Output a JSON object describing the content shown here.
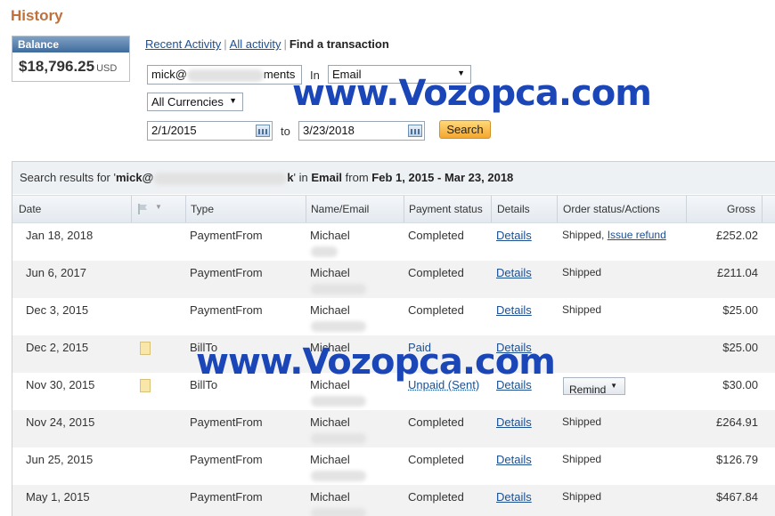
{
  "page": {
    "title": "History"
  },
  "balance": {
    "label": "Balance",
    "amount": "$18,796.25",
    "currency": "USD"
  },
  "tabs": {
    "recent": "Recent Activity",
    "all": "All activity",
    "find": "Find a transaction",
    "separator": "|"
  },
  "search": {
    "query_visible": "mick@",
    "query_suffix": "ments",
    "in_label": "In",
    "in_value": "Email",
    "currency_value": "All Currencies",
    "from_date": "2/1/2015",
    "to_label": "to",
    "to_date": "3/23/2018",
    "button": "Search"
  },
  "watermark": {
    "text": "www.Vozopca.com"
  },
  "results": {
    "prefix": "Search results for '",
    "query": "mick@",
    "query_tail": "k",
    "in_text": "' in",
    "field": "Email",
    "from_text": "from",
    "range": "Feb 1, 2015 - Mar 23, 2018"
  },
  "columns": {
    "date": "Date",
    "type": "Type",
    "name": "Name/Email",
    "status": "Payment status",
    "details": "Details",
    "order": "Order status/Actions",
    "gross": "Gross"
  },
  "rows": [
    {
      "date": "Jan 18, 2018",
      "type": "PaymentFrom",
      "name": "Michael",
      "status": "Completed",
      "details": "Details",
      "order": "Shipped,",
      "order_link": "Issue refund",
      "gross": "£252.02"
    },
    {
      "date": "Jun 6, 2017",
      "type": "PaymentFrom",
      "name": "Michael",
      "status": "Completed",
      "details": "Details",
      "order": "Shipped",
      "order_link": "",
      "gross": "£211.04"
    },
    {
      "date": "Dec 3, 2015",
      "type": "PaymentFrom",
      "name": "Michael",
      "status": "Completed",
      "details": "Details",
      "order": "Shipped",
      "order_link": "",
      "gross": "$25.00"
    },
    {
      "date": "Dec 2, 2015",
      "type": "BillTo",
      "name": "Michael",
      "status": "Paid",
      "details": "Details",
      "order": "",
      "order_link": "",
      "gross": "$25.00"
    },
    {
      "date": "Nov 30, 2015",
      "type": "BillTo",
      "name": "Michael",
      "status": "Unpaid (Sent)",
      "details": "Details",
      "order": "Remind",
      "order_link": "",
      "gross": "$30.00"
    },
    {
      "date": "Nov 24, 2015",
      "type": "PaymentFrom",
      "name": "Michael",
      "status": "Completed",
      "details": "Details",
      "order": "Shipped",
      "order_link": "",
      "gross": "£264.91"
    },
    {
      "date": "Jun 25, 2015",
      "type": "PaymentFrom",
      "name": "Michael",
      "status": "Completed",
      "details": "Details",
      "order": "Shipped",
      "order_link": "",
      "gross": "$126.79"
    },
    {
      "date": "May 1, 2015",
      "type": "PaymentFrom",
      "name": "Michael",
      "status": "Completed",
      "details": "Details",
      "order": "Shipped",
      "order_link": "",
      "gross": "$467.84"
    }
  ]
}
